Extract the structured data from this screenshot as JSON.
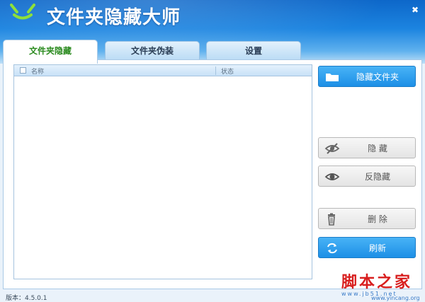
{
  "app": {
    "title": "文件夹隐藏大师",
    "close_glyph": "✖"
  },
  "tabs": [
    {
      "label": "文件夹隐藏",
      "active": true
    },
    {
      "label": "文件夹伪装",
      "active": false
    },
    {
      "label": "设置",
      "active": false
    }
  ],
  "list": {
    "columns": [
      "名称",
      "状态"
    ],
    "rows": []
  },
  "buttons": {
    "hide_folder": {
      "label": "隐藏文件夹",
      "icon": "folder-icon"
    },
    "hide": {
      "label": "隐 藏",
      "icon": "eye-hidden-icon"
    },
    "unhide": {
      "label": "反隐藏",
      "icon": "eye-icon"
    },
    "delete": {
      "label": "删 除",
      "icon": "trash-icon"
    },
    "refresh": {
      "label": "刷新",
      "icon": "refresh-icon"
    }
  },
  "footer": {
    "version": "版本：4.5.0.1"
  },
  "watermark": {
    "text": "脚本之家",
    "site1": "www.jb51.net",
    "site2": "www.yincang.org"
  },
  "colors": {
    "accent_blue": "#1d8fe6",
    "active_tab_text": "#2a8a1e",
    "header_blue": "#0d67c9",
    "watermark_red": "#d81e1e"
  }
}
